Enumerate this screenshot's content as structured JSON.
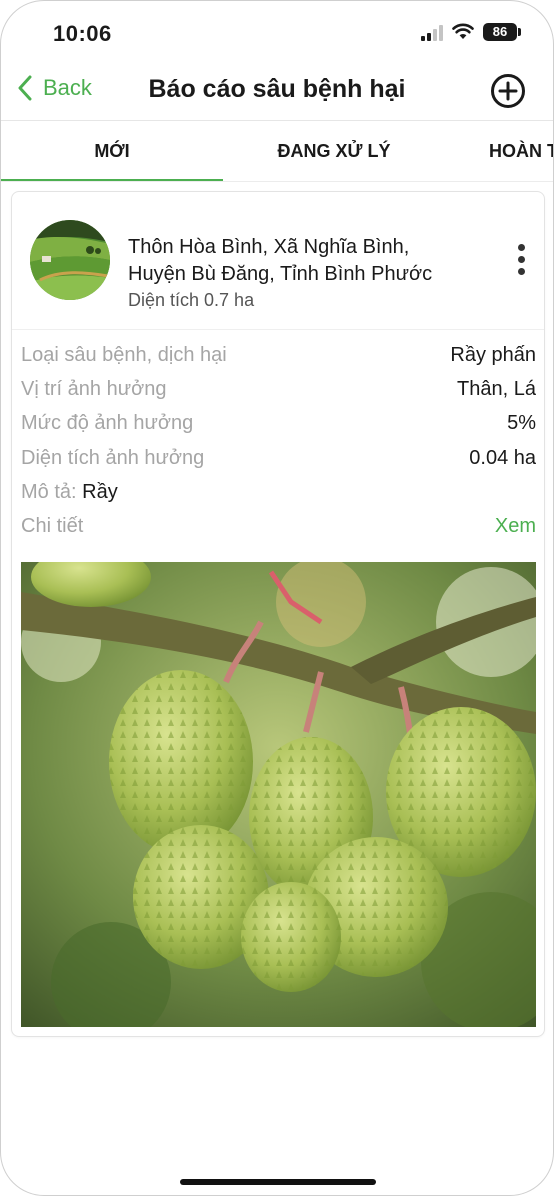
{
  "status_bar": {
    "time": "10:06",
    "battery": "86"
  },
  "nav": {
    "back_label": "Back",
    "title": "Báo cáo sâu bệnh hại"
  },
  "tabs": [
    {
      "label": "MỚI",
      "active": true
    },
    {
      "label": "ĐANG XỬ LÝ",
      "active": false
    },
    {
      "label": "HOÀN T",
      "active": false
    }
  ],
  "report": {
    "address_line1": "Thôn Hòa Bình, Xã Nghĩa Bình,",
    "address_line2": "Huyện Bù Đăng, Tỉnh Bình Phước",
    "area": "Diện tích 0.7 ha",
    "fields": [
      {
        "label": "Loại sâu bệnh, dịch hại",
        "value": "Rầy phấn"
      },
      {
        "label": "Vị trí ảnh hưởng",
        "value": "Thân, Lá"
      },
      {
        "label": "Mức độ ảnh hưởng",
        "value": "5%"
      },
      {
        "label": "Diện tích ảnh hưởng",
        "value": "0.04 ha"
      }
    ],
    "description_label": "Mô tả:",
    "description_value": "Rầy",
    "detail_label": "Chi tiết",
    "detail_link": "Xem"
  },
  "colors": {
    "accent": "#4caf50",
    "muted_label": "#a5a5a5"
  },
  "icons": [
    "chevron-left-icon",
    "plus-circle-icon",
    "more-vertical-icon",
    "wifi-icon",
    "signal-icon",
    "battery-icon"
  ]
}
